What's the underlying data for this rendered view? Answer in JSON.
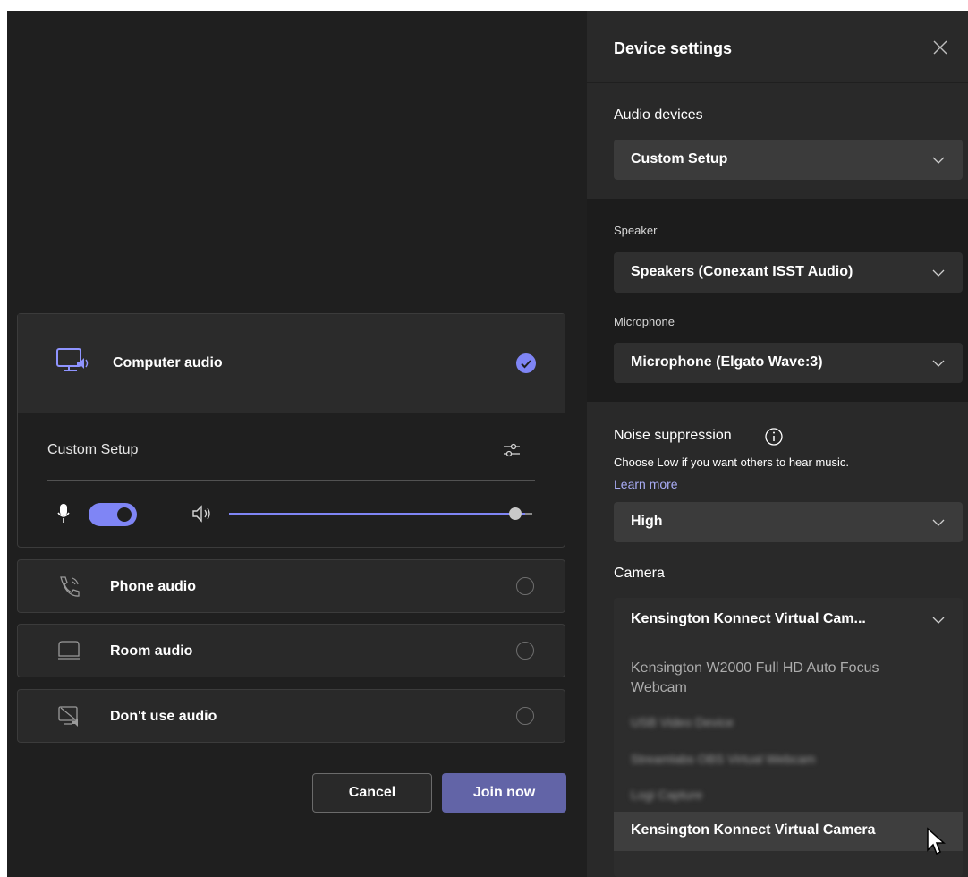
{
  "left": {
    "computer_audio": {
      "label": "Computer audio",
      "selected": true,
      "device_label": "Custom Setup",
      "mic_enabled": true,
      "volume_level": 0.97
    },
    "options": [
      {
        "label": "Phone audio",
        "icon": "phone-audio-icon"
      },
      {
        "label": "Room audio",
        "icon": "room-audio-icon"
      },
      {
        "label": "Don't use audio",
        "icon": "no-audio-icon"
      }
    ],
    "cancel_label": "Cancel",
    "join_label": "Join now"
  },
  "panel": {
    "title": "Device settings",
    "audio_devices_label": "Audio devices",
    "audio_devices_value": "Custom Setup",
    "speaker_label": "Speaker",
    "speaker_value": "Speakers (Conexant ISST Audio)",
    "microphone_label": "Microphone",
    "microphone_value": "Microphone (Elgato Wave:3)",
    "noise_label": "Noise suppression",
    "noise_hint": "Choose Low if you want others to hear music.",
    "learn_more": "Learn more",
    "noise_value": "High",
    "camera_label": "Camera",
    "camera_value": "Kensington Konnect Virtual Cam...",
    "camera_options": [
      "Kensington W2000 Full HD Auto Focus",
      "Webcam",
      "USB Video Device",
      "Streamlabs OBS Virtual Webcam",
      "Logi Capture",
      "Kensington Konnect Virtual Camera"
    ]
  },
  "colors": {
    "accent": "#7f85f5",
    "primary_button": "#6264a7",
    "link": "#a9acf5",
    "background": "#1f1f1f",
    "panel": "#292929"
  }
}
